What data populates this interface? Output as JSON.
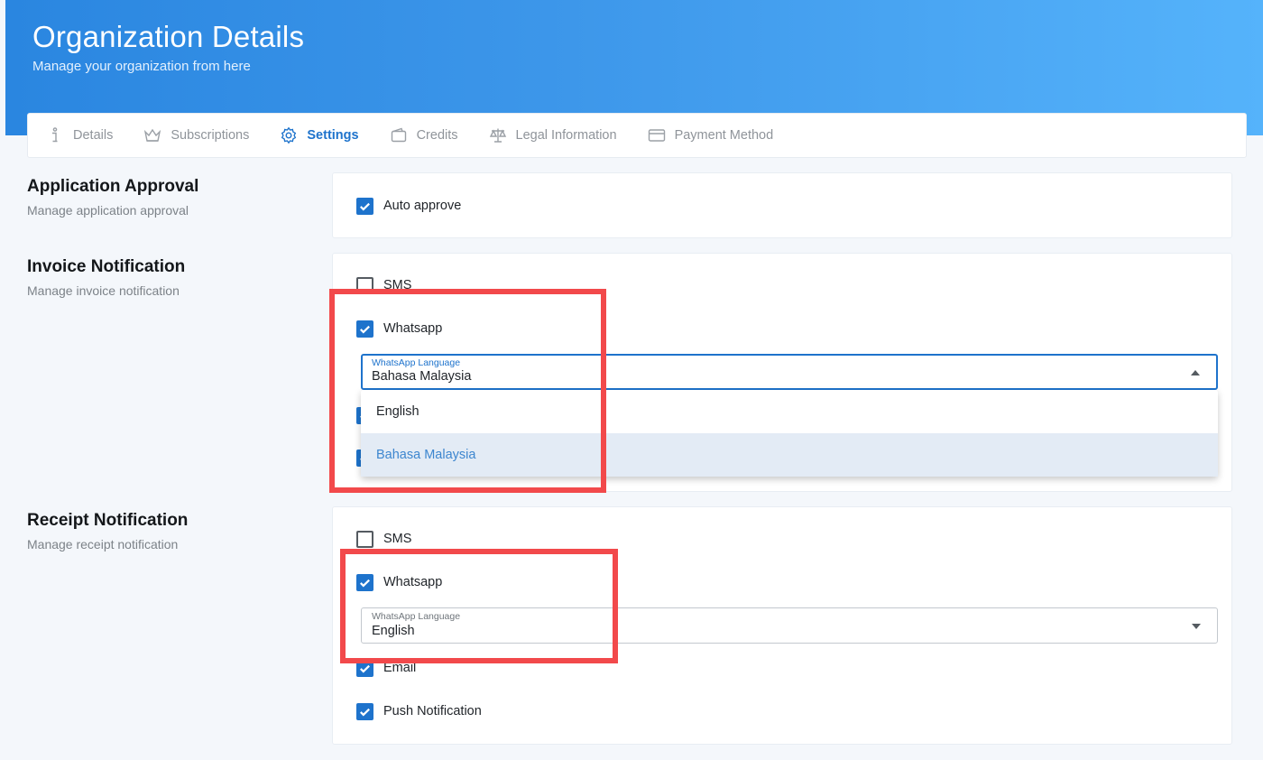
{
  "header": {
    "title": "Organization Details",
    "subtitle": "Manage your organization from here"
  },
  "tabs": [
    {
      "label": "Details",
      "icon": "info-icon",
      "active": false
    },
    {
      "label": "Subscriptions",
      "icon": "crown-icon",
      "active": false
    },
    {
      "label": "Settings",
      "icon": "gear-icon",
      "active": true
    },
    {
      "label": "Credits",
      "icon": "wallet-icon",
      "active": false
    },
    {
      "label": "Legal Information",
      "icon": "scale-icon",
      "active": false
    },
    {
      "label": "Payment Method",
      "icon": "card-icon",
      "active": false
    }
  ],
  "application_approval": {
    "title": "Application Approval",
    "subtitle": "Manage application approval",
    "auto_approve": {
      "label": "Auto approve",
      "checked": true
    }
  },
  "invoice_notification": {
    "title": "Invoice Notification",
    "subtitle": "Manage invoice notification",
    "sms": {
      "label": "SMS",
      "checked": false
    },
    "whatsapp": {
      "label": "Whatsapp",
      "checked": true
    },
    "language_select": {
      "label": "WhatsApp Language",
      "value": "Bahasa Malaysia",
      "open": true,
      "options": [
        "English",
        "Bahasa Malaysia"
      ],
      "selected_option": "Bahasa Malaysia"
    }
  },
  "receipt_notification": {
    "title": "Receipt Notification",
    "subtitle": "Manage receipt notification",
    "sms": {
      "label": "SMS",
      "checked": false
    },
    "whatsapp": {
      "label": "Whatsapp",
      "checked": true
    },
    "language_select": {
      "label": "WhatsApp Language",
      "value": "English",
      "open": false
    },
    "email": {
      "label": "Email",
      "checked": true
    },
    "push": {
      "label": "Push Notification",
      "checked": true
    }
  },
  "colors": {
    "accent": "#1e73cc",
    "highlight": "#f2494b",
    "header_gradient_start": "#2a86e0",
    "header_gradient_end": "#55b3fb"
  }
}
